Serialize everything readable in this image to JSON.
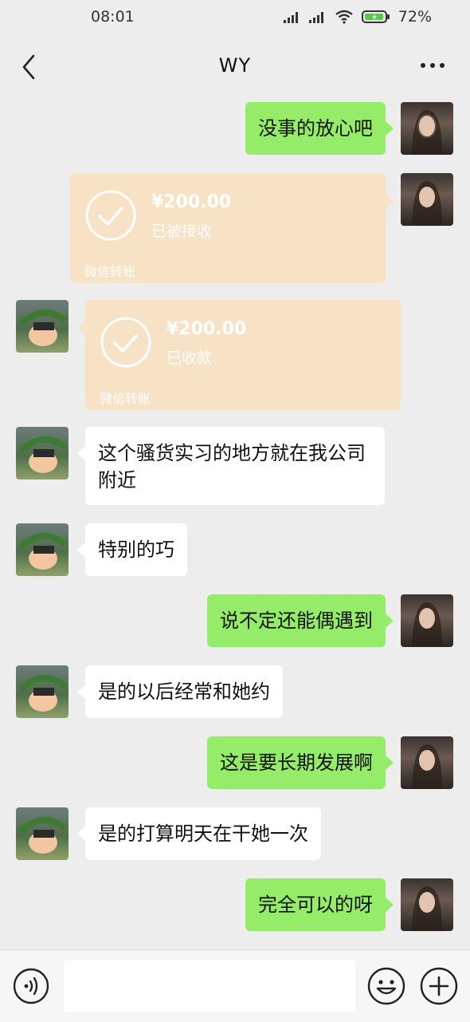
{
  "status_bar": {
    "time": "08:01",
    "battery": "72%"
  },
  "header": {
    "title": "WY"
  },
  "messages": [
    {
      "side": "right",
      "type": "text",
      "text": "没事的放心吧"
    },
    {
      "side": "right",
      "type": "transfer",
      "amount": "¥200.00",
      "status": "已被接收",
      "label": "微信转账"
    },
    {
      "side": "left",
      "type": "transfer",
      "amount": "¥200.00",
      "status": "已收款",
      "label": "微信转账"
    },
    {
      "side": "left",
      "type": "text",
      "text": "这个骚货实习的地方就在我公司附近"
    },
    {
      "side": "left",
      "type": "text",
      "text": "特别的巧"
    },
    {
      "side": "right",
      "type": "text",
      "text": "说不定还能偶遇到"
    },
    {
      "side": "left",
      "type": "text",
      "text": "是的以后经常和她约"
    },
    {
      "side": "right",
      "type": "text",
      "text": "这是要长期发展啊"
    },
    {
      "side": "left",
      "type": "text",
      "text": "是的打算明天在干她一次"
    },
    {
      "side": "right",
      "type": "text",
      "text": "完全可以的呀"
    }
  ],
  "colors": {
    "background": "#ededed",
    "sent_bubble": "#95ec69",
    "received_bubble": "#ffffff",
    "transfer_card": "#f8e2c6"
  },
  "icons": [
    "back-icon",
    "more-icon",
    "voice-icon",
    "emoji-icon",
    "plus-icon",
    "check-icon",
    "signal-icon",
    "wifi-icon",
    "battery-icon"
  ]
}
